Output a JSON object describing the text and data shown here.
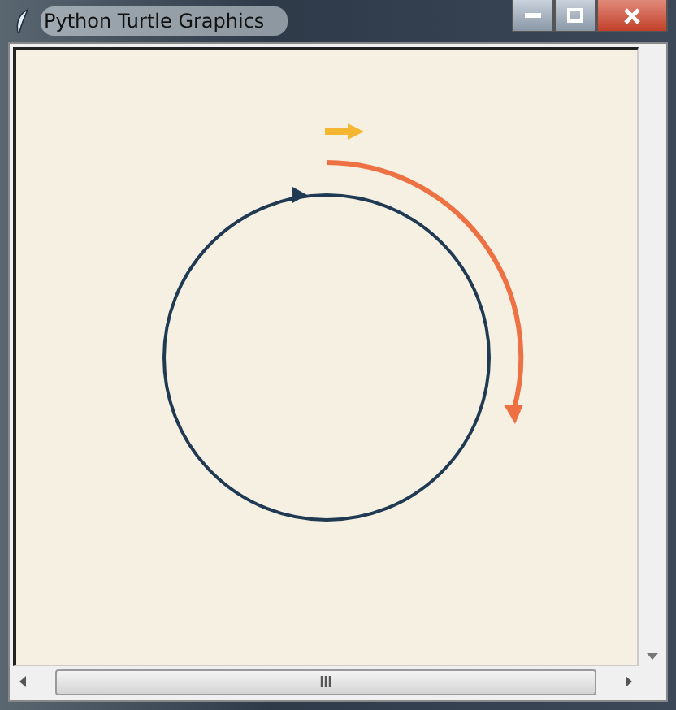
{
  "window": {
    "title": "Python Turtle Graphics"
  },
  "drawings": [
    {
      "kind": "circle",
      "color": "#1f3a52"
    },
    {
      "kind": "arc",
      "color": "#ee7144"
    },
    {
      "kind": "arrow",
      "color": "#f5b731"
    }
  ]
}
